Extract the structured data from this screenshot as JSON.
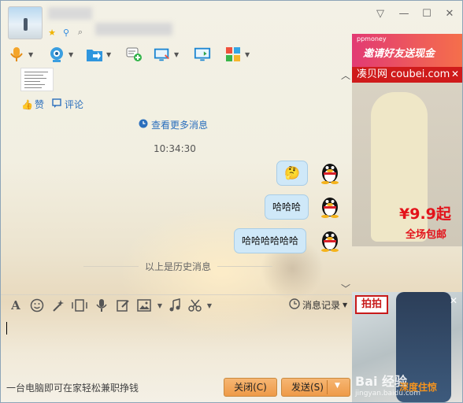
{
  "title_bar": {
    "window_controls": [
      "▽",
      "—",
      "☐",
      "✕"
    ]
  },
  "toolbar": {
    "items": [
      "microphone-icon",
      "video-camera-icon",
      "file-transfer-icon",
      "add-chat-icon",
      "remote-desktop-icon",
      "screen-share-icon",
      "apps-icon"
    ]
  },
  "chat": {
    "like_label": "赞",
    "comment_label": "评论",
    "view_more_label": "查看更多消息",
    "timestamp": "10:34:30",
    "messages": [
      {
        "text": "🤔",
        "type": "emoji"
      },
      {
        "text": "哈哈哈"
      },
      {
        "text": "哈哈哈哈哈哈"
      }
    ],
    "history_divider": "以上是历史消息"
  },
  "input_toolbar": {
    "icons": [
      "font-icon",
      "emoji-icon",
      "magic-icon",
      "screenshot-icon",
      "voice-icon",
      "edit-icon",
      "image-icon",
      "music-icon",
      "scissors-icon"
    ],
    "record_label": "消息记录"
  },
  "footer": {
    "tip_text": "一台电脑即可在家轻松兼职挣钱",
    "close_button": "关闭(C)",
    "send_button": "发送(S)"
  },
  "ads": {
    "ad1": {
      "brand_small": "ppmoney",
      "slogan": "邀请好友送现金",
      "site": "凑贝网 coubei.com",
      "price": "¥9.9起",
      "free_shipping": "全场包邮"
    },
    "ad2": {
      "tag": "拍拍",
      "watermark": "Bai 经验",
      "watermark_url": "jingyan.baidu.com",
      "promo": "深度住惊"
    }
  },
  "colors": {
    "accent_blue": "#2b6fbd",
    "bubble": "#cfe8f8",
    "button_orange": "#ee9a48"
  }
}
